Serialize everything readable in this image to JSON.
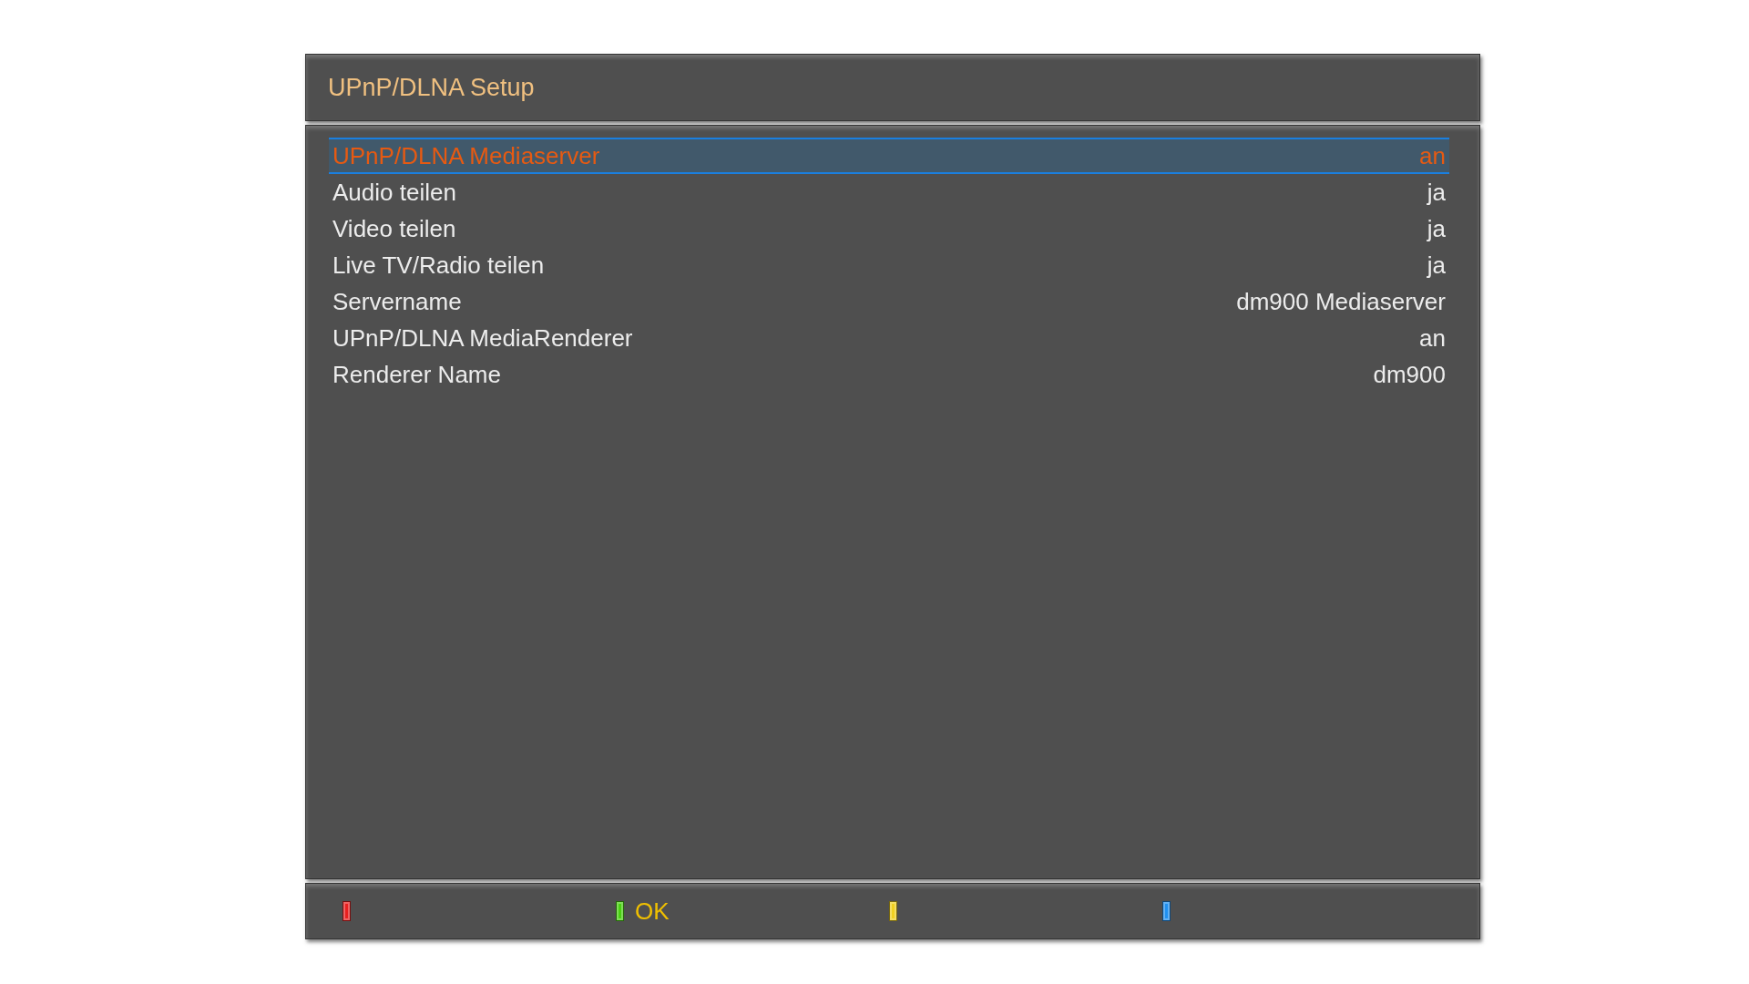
{
  "window": {
    "title": "UPnP/DLNA Setup"
  },
  "settings": [
    {
      "label": "UPnP/DLNA Mediaserver",
      "value": "an",
      "selected": true
    },
    {
      "label": "Audio teilen",
      "value": "ja",
      "selected": false
    },
    {
      "label": "Video teilen",
      "value": "ja",
      "selected": false
    },
    {
      "label": "Live TV/Radio teilen",
      "value": "ja",
      "selected": false
    },
    {
      "label": "Servername",
      "value": "dm900 Mediaserver",
      "selected": false
    },
    {
      "label": "UPnP/DLNA MediaRenderer",
      "value": "an",
      "selected": false
    },
    {
      "label": "Renderer Name",
      "value": "dm900",
      "selected": false
    }
  ],
  "color_keys": [
    {
      "color": "#e82020"
    },
    {
      "color": "#48d010",
      "label": "OK"
    },
    {
      "color": "#f0d020"
    },
    {
      "color": "#2090f0"
    }
  ]
}
